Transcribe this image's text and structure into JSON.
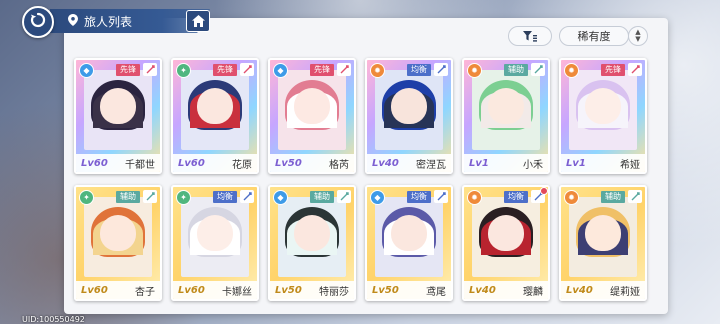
{
  "header": {
    "title": "旅人列表",
    "back_icon": "back-arrow-icon",
    "home_icon": "home-icon",
    "location_icon": "map-pin-icon"
  },
  "toolbar": {
    "filter_icon": "filter-icon",
    "sort_label": "稀有度",
    "sort_toggle_icon": "sort-order-icon"
  },
  "footer": {
    "uid": "UID:100550492"
  },
  "colors": {
    "header_blue": "#2c4a7d",
    "role_attack": "#e0506e",
    "role_balance": "#4d6fc9",
    "role_support": "#5aa9a0",
    "lv_purple": "#7c5fd2",
    "lv_gold": "#c08a1a"
  },
  "travelers": [
    {
      "name": "千都世",
      "level": "Lv60",
      "role": "先锋",
      "element": "water-icon",
      "rarity": "SSR",
      "notify": false
    },
    {
      "name": "花原",
      "level": "Lv60",
      "role": "先锋",
      "element": "wind-icon",
      "rarity": "SSR",
      "notify": false
    },
    {
      "name": "格芮",
      "level": "Lv50",
      "role": "先锋",
      "element": "water-icon",
      "rarity": "SSR",
      "notify": false
    },
    {
      "name": "密涅瓦",
      "level": "Lv40",
      "role": "均衡",
      "element": "fire-icon",
      "rarity": "SSR",
      "notify": false
    },
    {
      "name": "小禾",
      "level": "Lv1",
      "role": "辅助",
      "element": "fire-icon",
      "rarity": "SSR",
      "notify": false
    },
    {
      "name": "希娅",
      "level": "Lv1",
      "role": "先锋",
      "element": "fire-icon",
      "rarity": "SSR",
      "notify": false
    },
    {
      "name": "杏子",
      "level": "Lv60",
      "role": "辅助",
      "element": "wind-icon",
      "rarity": "SR",
      "notify": false
    },
    {
      "name": "卡娜丝",
      "level": "Lv60",
      "role": "均衡",
      "element": "wind-icon",
      "rarity": "SR",
      "notify": false
    },
    {
      "name": "特丽莎",
      "level": "Lv50",
      "role": "辅助",
      "element": "water-icon",
      "rarity": "SR",
      "notify": false
    },
    {
      "name": "鸢尾",
      "level": "Lv50",
      "role": "均衡",
      "element": "water-icon",
      "rarity": "SR",
      "notify": false
    },
    {
      "name": "璎麟",
      "level": "Lv40",
      "role": "均衡",
      "element": "fire-icon",
      "rarity": "SR",
      "notify": true
    },
    {
      "name": "缇莉娅",
      "level": "Lv40",
      "role": "辅助",
      "element": "fire-icon",
      "rarity": "SR",
      "notify": false
    }
  ]
}
